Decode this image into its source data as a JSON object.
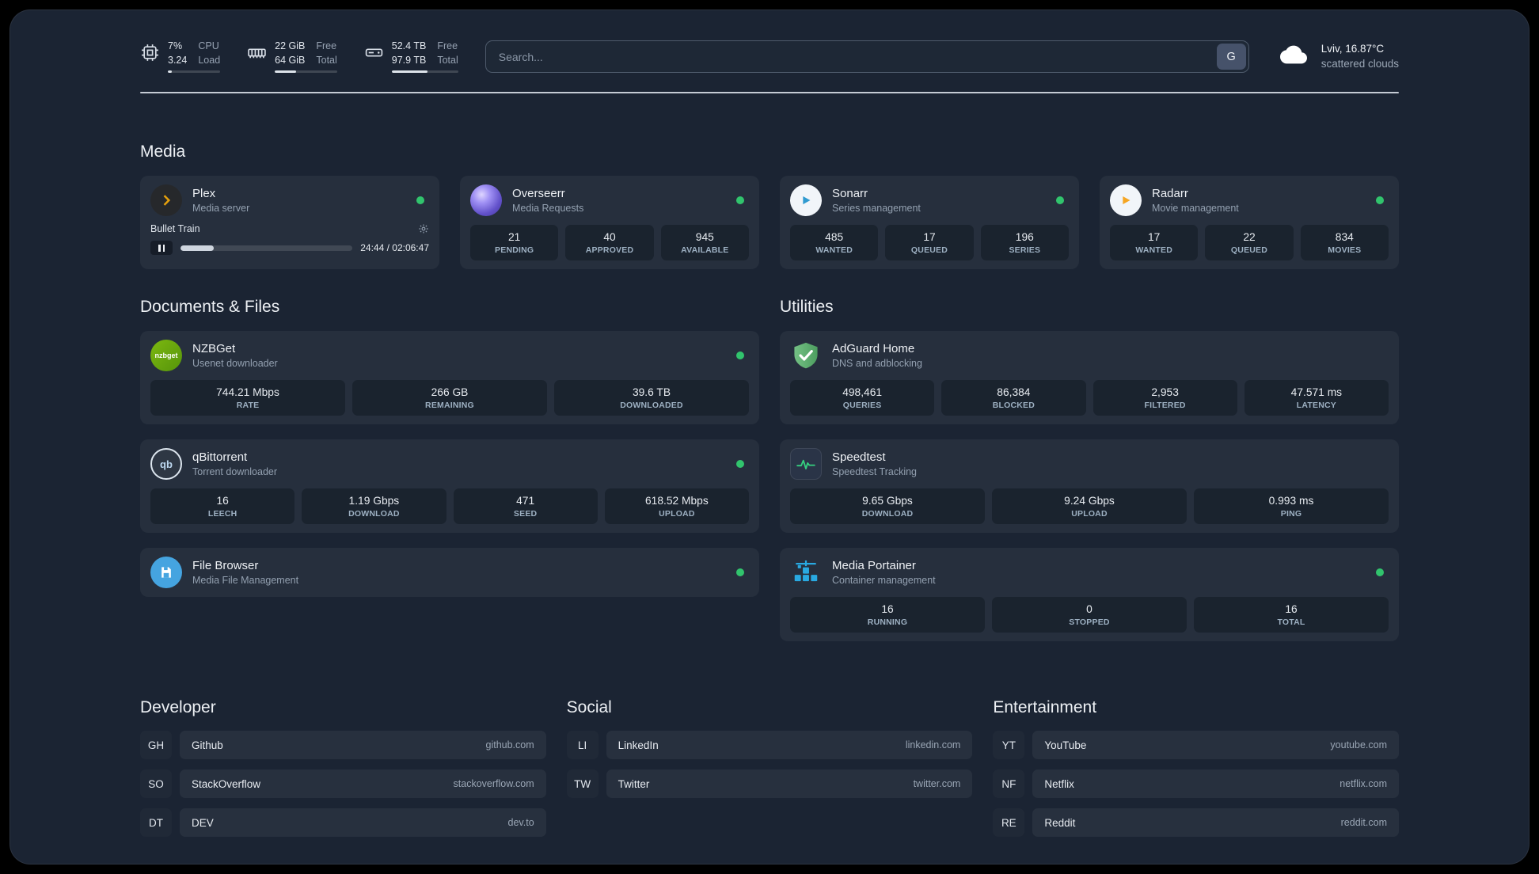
{
  "topbar": {
    "cpu": {
      "value1": "7%",
      "value2": "3.24",
      "label1": "CPU",
      "label2": "Load"
    },
    "ram": {
      "value1": "22 GiB",
      "value2": "64 GiB",
      "label1": "Free",
      "label2": "Total"
    },
    "disk": {
      "value1": "52.4 TB",
      "value2": "97.9 TB",
      "label1": "Free",
      "label2": "Total"
    },
    "search": {
      "placeholder": "Search...",
      "engine_label": "G"
    },
    "weather": {
      "location": "Lviv, 16.87°C",
      "condition": "scattered clouds"
    }
  },
  "sections": {
    "media": "Media",
    "documents": "Documents & Files",
    "utilities": "Utilities",
    "developer": "Developer",
    "social": "Social",
    "entertainment": "Entertainment"
  },
  "media": {
    "plex": {
      "name": "Plex",
      "desc": "Media server",
      "track": "Bullet Train",
      "time": "24:44 / 02:06:47"
    },
    "overseerr": {
      "name": "Overseerr",
      "desc": "Media Requests",
      "stats": [
        {
          "value": "21",
          "label": "PENDING"
        },
        {
          "value": "40",
          "label": "APPROVED"
        },
        {
          "value": "945",
          "label": "AVAILABLE"
        }
      ]
    },
    "sonarr": {
      "name": "Sonarr",
      "desc": "Series management",
      "stats": [
        {
          "value": "485",
          "label": "WANTED"
        },
        {
          "value": "17",
          "label": "QUEUED"
        },
        {
          "value": "196",
          "label": "SERIES"
        }
      ]
    },
    "radarr": {
      "name": "Radarr",
      "desc": "Movie management",
      "stats": [
        {
          "value": "17",
          "label": "WANTED"
        },
        {
          "value": "22",
          "label": "QUEUED"
        },
        {
          "value": "834",
          "label": "MOVIES"
        }
      ]
    }
  },
  "documents": {
    "nzbget": {
      "name": "NZBGet",
      "desc": "Usenet downloader",
      "icon_text": "nzbget",
      "stats": [
        {
          "value": "744.21 Mbps",
          "label": "RATE"
        },
        {
          "value": "266 GB",
          "label": "REMAINING"
        },
        {
          "value": "39.6 TB",
          "label": "DOWNLOADED"
        }
      ]
    },
    "qbittorrent": {
      "name": "qBittorrent",
      "desc": "Torrent downloader",
      "icon_text": "qb",
      "stats": [
        {
          "value": "16",
          "label": "LEECH"
        },
        {
          "value": "1.19 Gbps",
          "label": "DOWNLOAD"
        },
        {
          "value": "471",
          "label": "SEED"
        },
        {
          "value": "618.52 Mbps",
          "label": "UPLOAD"
        }
      ]
    },
    "filebrowser": {
      "name": "File Browser",
      "desc": "Media File Management"
    }
  },
  "utilities": {
    "adguard": {
      "name": "AdGuard Home",
      "desc": "DNS and adblocking",
      "stats": [
        {
          "value": "498,461",
          "label": "QUERIES"
        },
        {
          "value": "86,384",
          "label": "BLOCKED"
        },
        {
          "value": "2,953",
          "label": "FILTERED"
        },
        {
          "value": "47.571 ms",
          "label": "LATENCY"
        }
      ]
    },
    "speedtest": {
      "name": "Speedtest",
      "desc": "Speedtest Tracking",
      "stats": [
        {
          "value": "9.65 Gbps",
          "label": "DOWNLOAD"
        },
        {
          "value": "9.24 Gbps",
          "label": "UPLOAD"
        },
        {
          "value": "0.993 ms",
          "label": "PING"
        }
      ]
    },
    "portainer": {
      "name": "Media Portainer",
      "desc": "Container management",
      "stats": [
        {
          "value": "16",
          "label": "RUNNING"
        },
        {
          "value": "0",
          "label": "STOPPED"
        },
        {
          "value": "16",
          "label": "TOTAL"
        }
      ]
    }
  },
  "bookmarks": {
    "developer": [
      {
        "abbr": "GH",
        "name": "Github",
        "url": "github.com"
      },
      {
        "abbr": "SO",
        "name": "StackOverflow",
        "url": "stackoverflow.com"
      },
      {
        "abbr": "DT",
        "name": "DEV",
        "url": "dev.to"
      }
    ],
    "social": [
      {
        "abbr": "LI",
        "name": "LinkedIn",
        "url": "linkedin.com"
      },
      {
        "abbr": "TW",
        "name": "Twitter",
        "url": "twitter.com"
      }
    ],
    "entertainment": [
      {
        "abbr": "YT",
        "name": "YouTube",
        "url": "youtube.com"
      },
      {
        "abbr": "NF",
        "name": "Netflix",
        "url": "netflix.com"
      },
      {
        "abbr": "RE",
        "name": "Reddit",
        "url": "reddit.com"
      }
    ]
  },
  "colors": {
    "background": "#1b2433",
    "card": "#28324466",
    "status_online": "#31c46d",
    "plex_accent": "#e5a00d",
    "sonarr_accent": "#2f9ad0",
    "radarr_accent": "#f5a623",
    "speedtest_accent": "#35d07f",
    "portainer_accent": "#29a9e1"
  },
  "icons": {
    "cpu": "chip",
    "memory": "ram-stick",
    "disk": "hard-drive",
    "weather": "cloud",
    "settings": "gear",
    "pause": "pause-bars",
    "status": "green-dot"
  }
}
